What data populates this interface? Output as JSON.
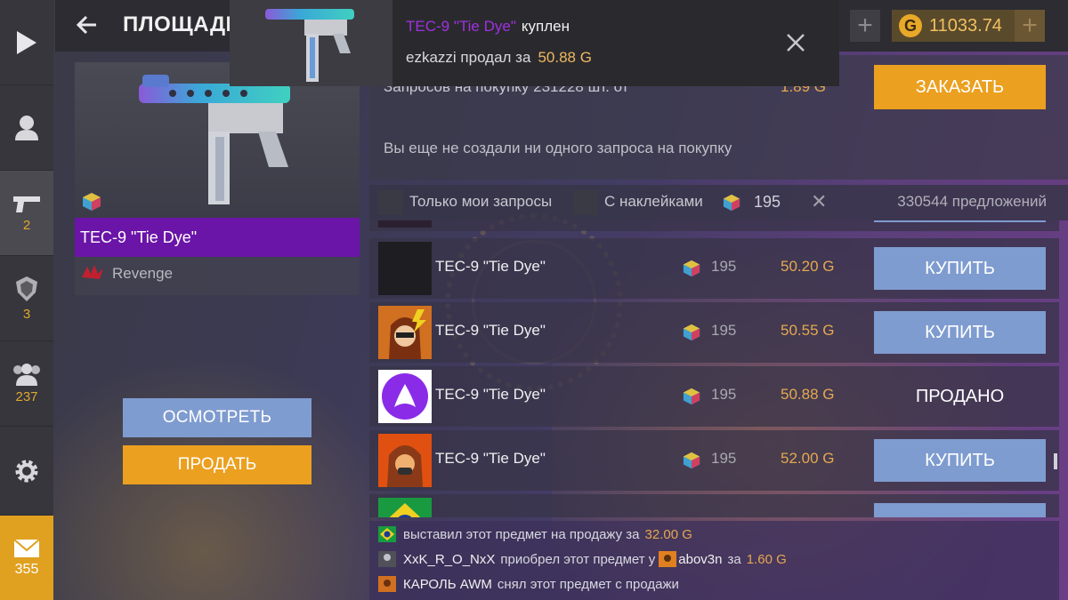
{
  "topbar": {
    "title": "ПЛОЩАДКА: T",
    "partial_value": "3",
    "currency": "11033.74",
    "currency_symbol": "G"
  },
  "sidebar": {
    "items": [
      {
        "icon": "play-icon",
        "count": ""
      },
      {
        "icon": "profile-icon",
        "count": ""
      },
      {
        "icon": "pistol-icon",
        "count": "2"
      },
      {
        "icon": "badge-icon",
        "count": "3"
      },
      {
        "icon": "friends-icon",
        "count": "237"
      },
      {
        "icon": "gear-icon",
        "count": ""
      }
    ],
    "mail_count": "355"
  },
  "item": {
    "name": "TEC-9 \"Tie Dye\"",
    "collection": "Revenge",
    "inspect_label": "ОСМОТРЕТЬ",
    "sell_label": "ПРОДАТЬ"
  },
  "requests": {
    "summary": "Запросов на покупку 231228 шт. от",
    "price": "1.89 G",
    "order_label": "ЗАКАЗАТЬ",
    "empty_text": "Вы еще не создали ни одного запроса на покупку"
  },
  "filters": {
    "only_mine": "Только мои запросы",
    "with_stickers": "С наклейками",
    "pattern_value": "195",
    "offers_count": "330544 предложений"
  },
  "listings": [
    {
      "name": "TEC-9 \"Tie Dye\"",
      "stat": "195",
      "price": "50.20 G",
      "action": "КУПИТЬ",
      "sold": false,
      "avatar": "dark"
    },
    {
      "name": "TEC-9 \"Tie Dye\"",
      "stat": "195",
      "price": "50.55 G",
      "action": "КУПИТЬ",
      "sold": false,
      "avatar": "hood"
    },
    {
      "name": "TEC-9 \"Tie Dye\"",
      "stat": "195",
      "price": "50.88 G",
      "action": "ПРОДАНО",
      "sold": true,
      "avatar": "alice"
    },
    {
      "name": "TEC-9 \"Tie Dye\"",
      "stat": "195",
      "price": "52.00 G",
      "action": "КУПИТЬ",
      "sold": false,
      "avatar": "fire"
    }
  ],
  "activity": [
    {
      "user": "",
      "text": "выставил этот предмет на продажу за",
      "amount": "32.00 G",
      "icon": "brazil-flag-icon"
    },
    {
      "user": "XxK_R_O_NxX",
      "text": "приобрел этот предмет у",
      "seller": "abov3n",
      "mid": "за",
      "amount": "1.60 G",
      "icon": "user-avatar-icon"
    },
    {
      "user": "КАРОЛЬ AWM",
      "text": "снял этот предмет с продажи",
      "amount": "",
      "icon": "user-avatar-icon"
    }
  ],
  "notification": {
    "item_name": "TEC-9 \"Tie Dye\"",
    "status": "куплен",
    "seller": "ezkazzi",
    "sold_text": "продал за",
    "amount": "50.88 G"
  },
  "colors": {
    "accent_orange": "#eba020",
    "accent_blue": "#7f9cd0",
    "rarity_purple": "#6a14a8",
    "gold_text": "#e4a850"
  }
}
